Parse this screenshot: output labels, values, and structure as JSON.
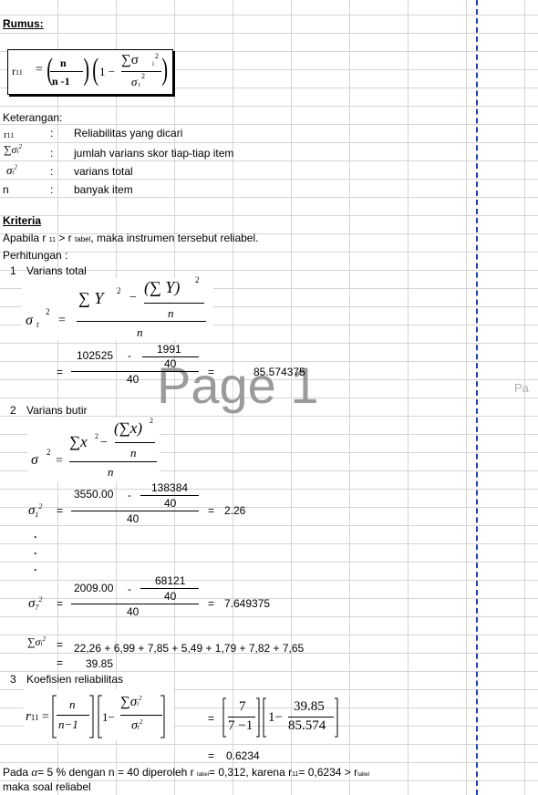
{
  "heading_rumus": "Rumus:",
  "formula_main": {
    "lhs": "r11",
    "n_num": "n",
    "n_den": "n -1",
    "one_minus": "1 −",
    "sum_sig": "∑σ",
    "sig_sub": "i",
    "sig_t": "σ",
    "sig_t_sub": "t",
    "sq": "2",
    "eq": "=",
    "open": "(",
    "close": ")"
  },
  "keterangan": {
    "title": "Keterangan:",
    "rows": [
      {
        "sym": "r11",
        "colon": ":",
        "desc": "Reliabilitas yang dicari"
      },
      {
        "sym": "∑σi²",
        "colon": ":",
        "desc": "jumlah varians skor tiap-tiap item"
      },
      {
        "sym": "σt²",
        "colon": ":",
        "desc": "varians total"
      },
      {
        "sym": "n",
        "colon": ":",
        "desc": "banyak item"
      }
    ]
  },
  "kriteria": {
    "title": "Kriteria",
    "text_a": "Apabila r",
    "sub11": "11",
    "text_b": "> r",
    "subtabel": "tabel",
    "text_c": ", maka instrumen tersebut reliabel."
  },
  "perhitungan": "Perhitungan :",
  "step1": {
    "num": "1",
    "title": "Varians total",
    "formula": {
      "sigma": "σ",
      "t": "t",
      "sq": "2",
      "eq": "=",
      "sumY2": "∑ Y",
      "minus": "−",
      "sumY": "(∑ Y)",
      "n": "n"
    },
    "calc": {
      "eq": "=",
      "a": "102525",
      "minus": "-",
      "b": "1991",
      "c": "40",
      "d": "40",
      "eq2": "=",
      "result": "85.574375"
    }
  },
  "step2": {
    "num": "2",
    "title": "Varians butir",
    "formula": {
      "sigma": "σ",
      "sq": "2",
      "eq": "=",
      "sumx2": "∑x",
      "minus": "−",
      "sumx": "(∑x)",
      "n": "n"
    },
    "item1": {
      "sym": "σ",
      "sub": "1",
      "eq": "=",
      "a": "3550.00",
      "minus": "-",
      "b": "138384",
      "c": "40",
      "d": "40",
      "eq2": "=",
      "result": "2.26"
    },
    "dots": ".",
    "item7": {
      "sym": "σ",
      "sub": "7",
      "eq": "=",
      "a": "2009.00",
      "minus": "-",
      "b": "68121",
      "c": "40",
      "d": "40",
      "eq2": "=",
      "result": "7.649375"
    },
    "sum": {
      "sym": "∑σ",
      "sub": "i",
      "eq": "=",
      "expr": "22,26 + 6,99 + 7,85 + 5,49 + 1,79 + 7,82 + 7,65",
      "eq2": "=",
      "result": "39.85"
    }
  },
  "step3": {
    "num": "3",
    "title": "Koefisien reliabilitas",
    "formula": {
      "lhs": "r",
      "lhs_sub": "11",
      "eq": "=",
      "n": "n",
      "n1": "n−1",
      "one_minus": "1−",
      "sum": "∑σ",
      "i": "i",
      "sigma_t": "σ",
      "t": "t",
      "sq": "2"
    },
    "calc": {
      "eq": "=",
      "seven": "7",
      "sevenm1": "7 −1",
      "one_minus": "1−",
      "num": "39.85",
      "den": "85.574"
    },
    "result_eq": "=",
    "result": "0.6234"
  },
  "conclusion": {
    "pada": "Pada",
    "alpha": "α",
    "rest": "= 5 % dengan n = 40 diperoleh r",
    "tabel1": "tabel",
    "rest2": "= 0,312, karena r",
    "sub11": "11",
    "rest3": "= 0,6234 > r",
    "tabel2": "tabel",
    "line2": "maka soal reliabel"
  },
  "watermark": "Page 1",
  "watermark_edge": "Pa",
  "colors": {
    "grid": "#d4d4d4",
    "page_break": "#1f3fbf",
    "watermark": "#8a8a8a"
  }
}
